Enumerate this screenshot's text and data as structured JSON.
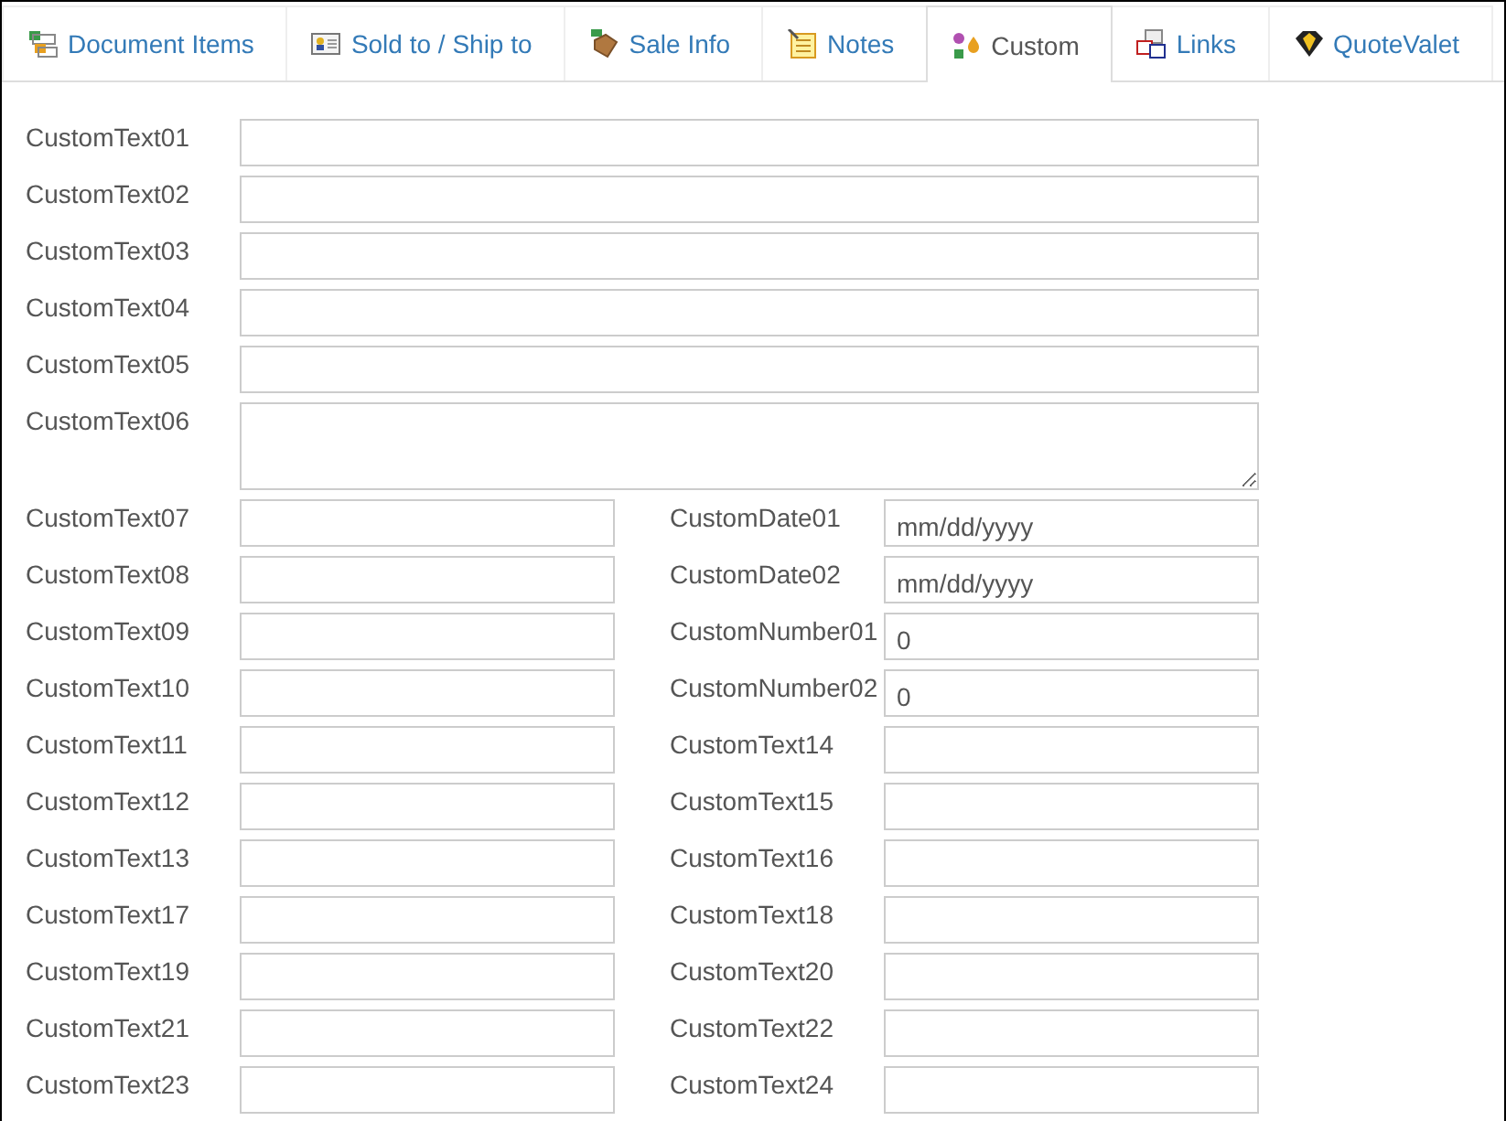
{
  "tabs": [
    {
      "label": "Document Items",
      "selected": false
    },
    {
      "label": "Sold to / Ship to",
      "selected": false
    },
    {
      "label": "Sale Info",
      "selected": false
    },
    {
      "label": "Notes",
      "selected": false
    },
    {
      "label": "Custom",
      "selected": true
    },
    {
      "label": "Links",
      "selected": false
    },
    {
      "label": "QuoteValet",
      "selected": false
    }
  ],
  "full_fields": [
    {
      "label": "CustomText01"
    },
    {
      "label": "CustomText02"
    },
    {
      "label": "CustomText03"
    },
    {
      "label": "CustomText04"
    },
    {
      "label": "CustomText05"
    },
    {
      "label": "CustomText06",
      "kind": "textarea"
    }
  ],
  "paired_rows": [
    [
      {
        "label": "CustomText07"
      },
      {
        "label": "CustomDate01",
        "placeholder": "mm/dd/yyyy"
      }
    ],
    [
      {
        "label": "CustomText08"
      },
      {
        "label": "CustomDate02",
        "placeholder": "mm/dd/yyyy"
      }
    ],
    [
      {
        "label": "CustomText09"
      },
      {
        "label": "CustomNumber01",
        "value": "0"
      }
    ],
    [
      {
        "label": "CustomText10"
      },
      {
        "label": "CustomNumber02",
        "value": "0"
      }
    ],
    [
      {
        "label": "CustomText11"
      },
      {
        "label": "CustomText14"
      }
    ],
    [
      {
        "label": "CustomText12"
      },
      {
        "label": "CustomText15"
      }
    ],
    [
      {
        "label": "CustomText13"
      },
      {
        "label": "CustomText16"
      }
    ],
    [
      {
        "label": "CustomText17"
      },
      {
        "label": "CustomText18"
      }
    ],
    [
      {
        "label": "CustomText19"
      },
      {
        "label": "CustomText20"
      }
    ],
    [
      {
        "label": "CustomText21"
      },
      {
        "label": "CustomText22"
      }
    ],
    [
      {
        "label": "CustomText23"
      },
      {
        "label": "CustomText24"
      }
    ]
  ]
}
